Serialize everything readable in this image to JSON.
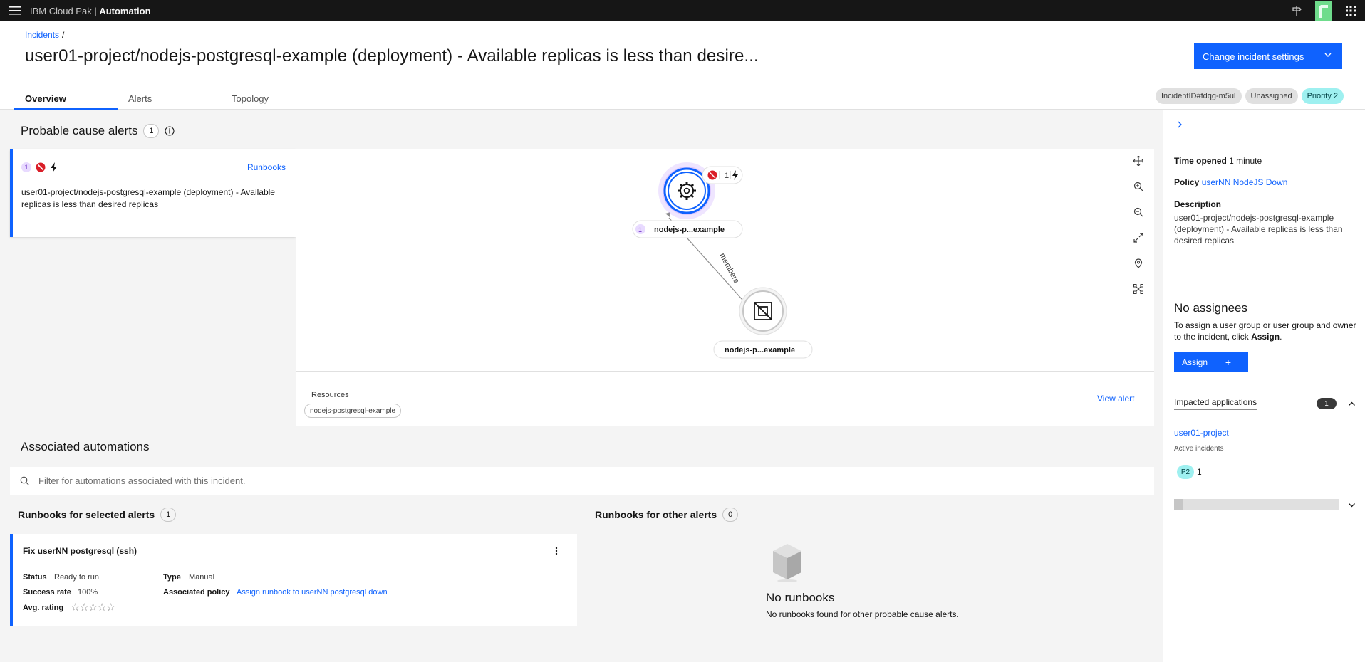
{
  "topbar": {
    "brand_prefix": "IBM Cloud Pak",
    "brand_sep": " | ",
    "brand_name": "Automation"
  },
  "header": {
    "breadcrumb": "Incidents",
    "breadcrumb_sep": "/",
    "title": "user01-project/nodejs-postgresql-example (deployment) - Available replicas is less than desire...",
    "change_button": "Change incident settings",
    "tabs": [
      "Overview",
      "Alerts",
      "Topology"
    ],
    "tags": {
      "incident_id": "IncidentID#fdqg-m5ul",
      "assignee": "Unassigned",
      "priority": "Priority 2"
    }
  },
  "probable": {
    "title": "Probable cause alerts",
    "count": "1",
    "alert": {
      "badge": "1",
      "runbooks_link": "Runbooks",
      "text": "user01-project/nodejs-postgresql-example (deployment) - Available replicas is less than desired replicas"
    }
  },
  "topology": {
    "node1_label": "nodejs-p...example",
    "node1_badge": "1",
    "node1_alert_count": "1",
    "edge_label": "members",
    "node2_label": "nodejs-p...example",
    "resources_title": "Resources",
    "resource_tag": "nodejs-postgresql-example",
    "view_alert": "View alert"
  },
  "automations": {
    "title": "Associated automations",
    "filter_placeholder": "Filter for automations associated with this incident.",
    "selected_title": "Runbooks for selected alerts",
    "selected_count": "1",
    "other_title": "Runbooks for other alerts",
    "other_count": "0",
    "runbook": {
      "name": "Fix userNN postgresql (ssh)",
      "status_label": "Status",
      "status_value": "Ready to run",
      "success_label": "Success rate",
      "success_value": "100%",
      "rating_label": "Avg. rating",
      "rating_stars": "☆☆☆☆☆",
      "type_label": "Type",
      "type_value": "Manual",
      "policy_label": "Associated policy",
      "policy_link": "Assign runbook to userNN postgresql down"
    },
    "empty_title": "No runbooks",
    "empty_text": "No runbooks found for other probable cause alerts."
  },
  "side": {
    "time_label": "Time opened",
    "time_value": "1 minute",
    "policy_label": "Policy",
    "policy_value": "userNN NodeJS Down",
    "desc_label": "Description",
    "desc_value": "user01-project/nodejs-postgresql-example (deployment) - Available replicas is less than desired replicas",
    "assignees_title": "No assignees",
    "assignees_text_a": "To assign a user group or user group and owner to the incident, click ",
    "assignees_text_b": "Assign",
    "assignees_text_c": ".",
    "assign_button": "Assign",
    "assign_plus": "+",
    "impacted_title": "Impacted applications",
    "impacted_count": "1",
    "app_link": "user01-project",
    "active_incidents": "Active incidents",
    "p2_tag": "P2",
    "p2_count": "1"
  },
  "colors": {
    "accent": "#0f62fe",
    "danger": "#da1e28",
    "teal": "#9ef0f0",
    "purple_badge": "#e8daff"
  }
}
